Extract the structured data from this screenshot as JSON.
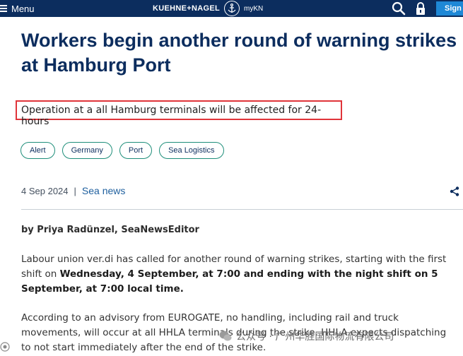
{
  "topbar": {
    "menu_label": "Menu",
    "brand_text": "KUEHNE+NAGEL",
    "brand_kn": "myKN",
    "sign_label": "Sign"
  },
  "article": {
    "headline": "Workers begin another round of warning strikes at Hamburg Port",
    "subtitle": "Operation at a all Hamburg terminals will be affected for 24-hours",
    "tags": [
      "Alert",
      "Germany",
      "Port",
      "Sea Logistics"
    ],
    "date": "4 Sep 2024",
    "separator": "|",
    "category": "Sea news",
    "byline": "by Priya Radünzel, SeaNewsEditor",
    "p1_a": "Labour union ver.di has called for another round of warning strikes, starting with the first shift on ",
    "p1_b": "Wednesday, 4 September, at 7:00 and ending with the night shift on 5 September, at 7:00 local time.",
    "p2": "According to an advisory from EUROGATE, no handling, including rail and truck movements, will occur at all HHLA terminals during the strike. HHLA expects dispatching to not start immediately after the end of the strike."
  },
  "watermark": {
    "text": "公众号 · 广州华胜国际物流有限公司"
  },
  "colors": {
    "nav_bg": "#0c2d5e",
    "headline": "#0c2d5e",
    "highlight_border": "#e0343a",
    "tag_border": "#1e8e7a",
    "sign_button": "#1e88d6"
  }
}
